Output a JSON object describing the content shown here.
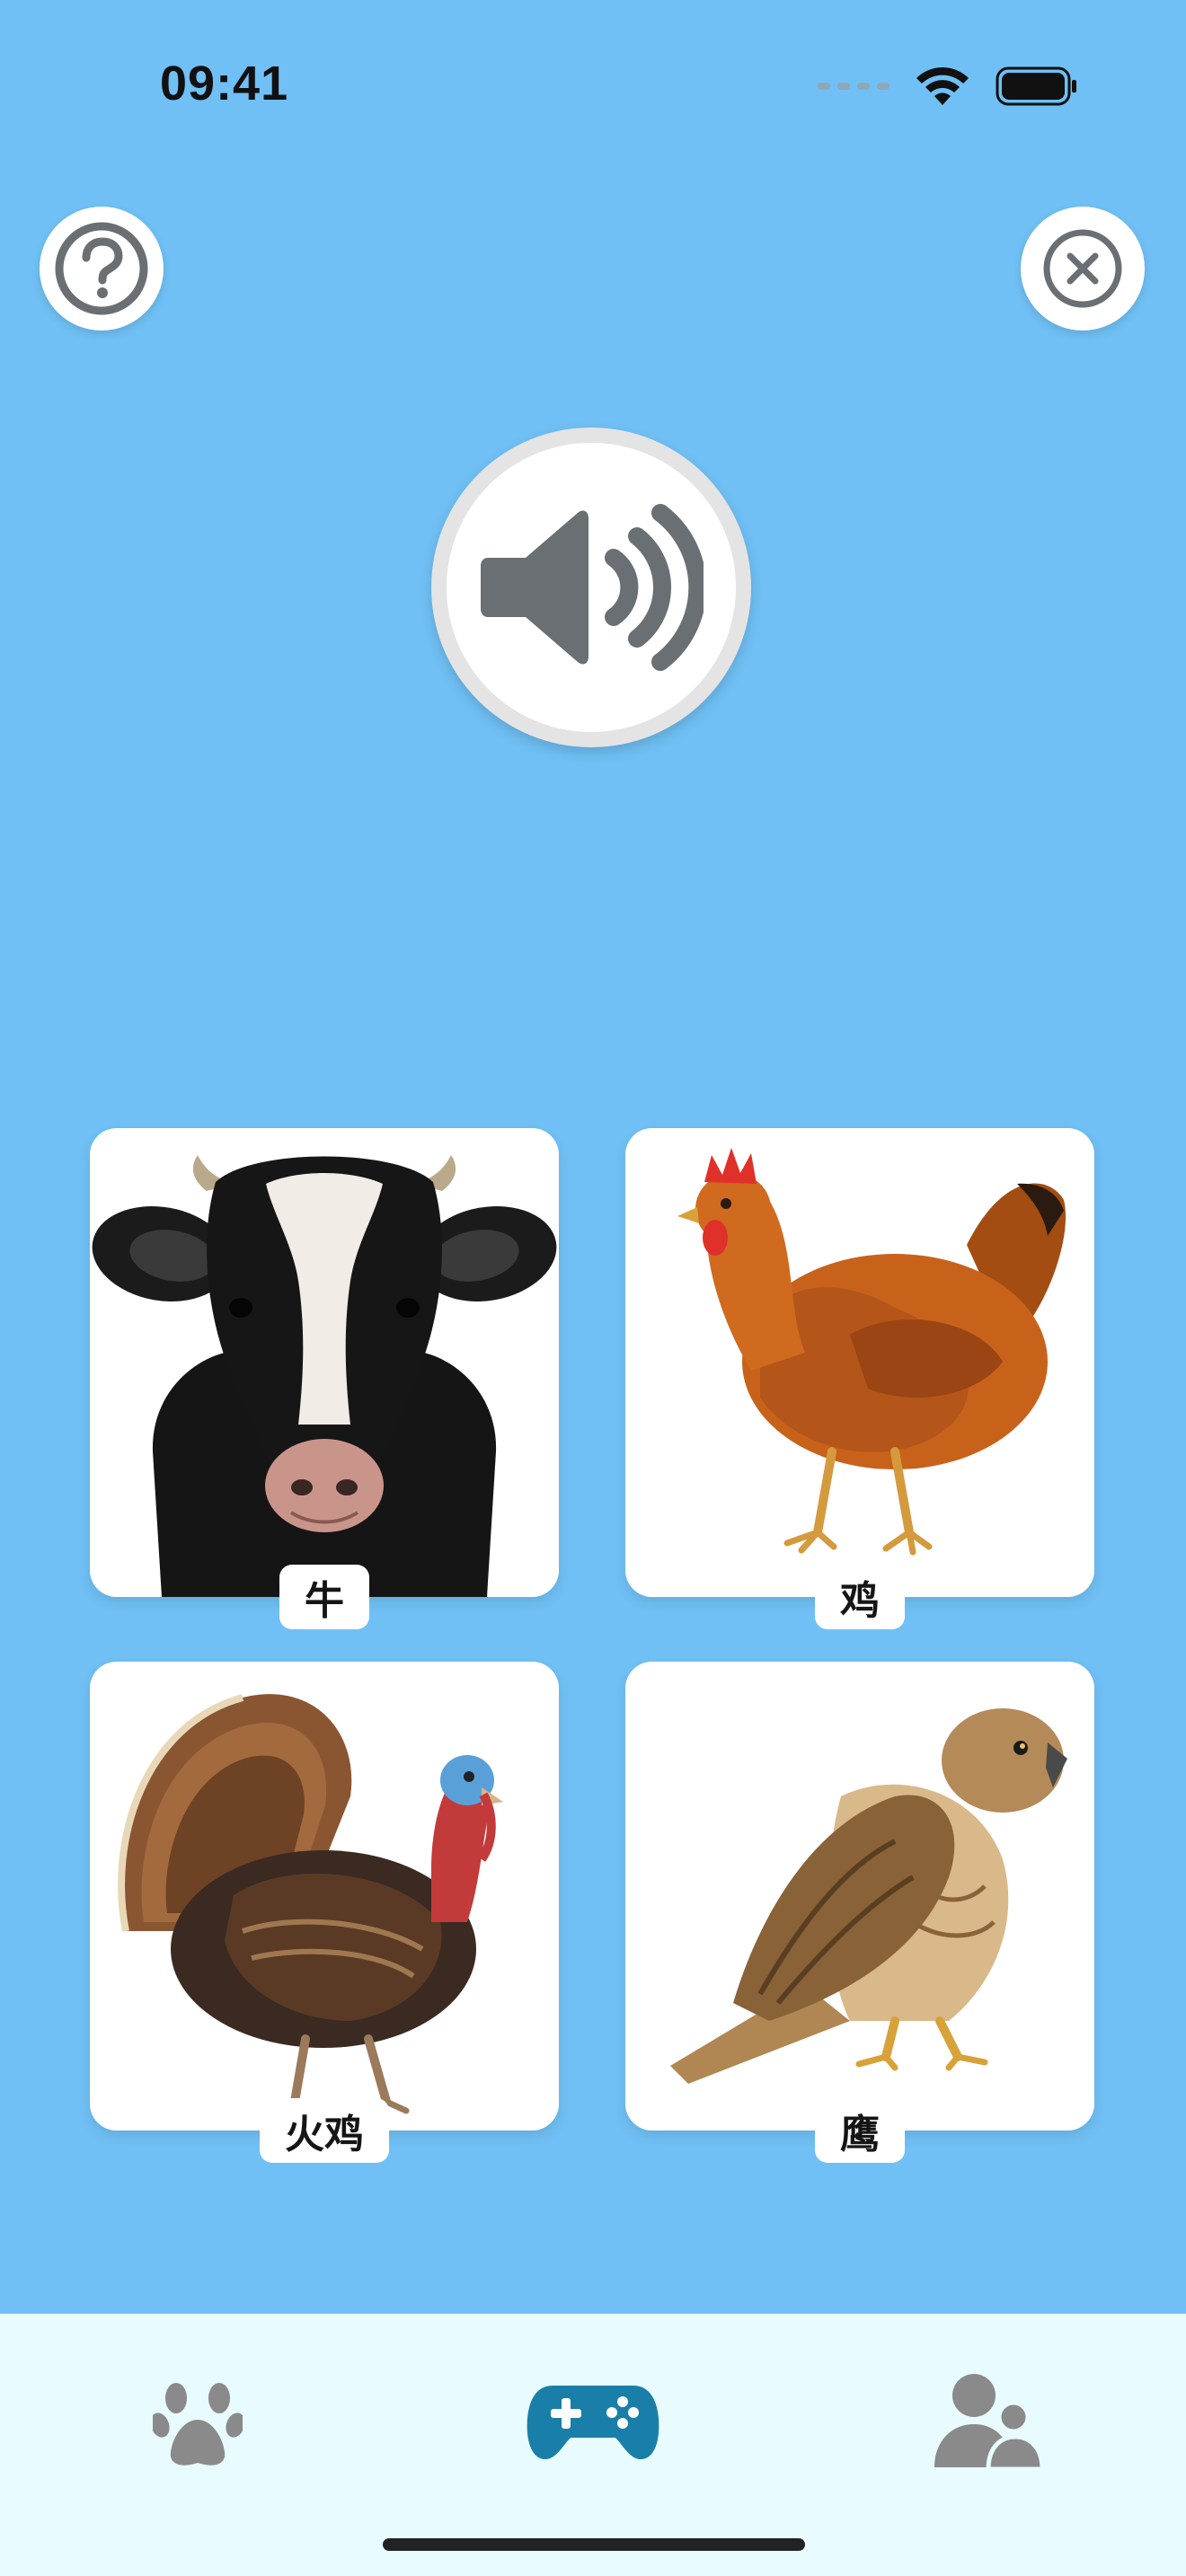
{
  "status_bar": {
    "time": "09:41"
  },
  "icons": {
    "help": "question-circle-icon",
    "close": "x-circle-icon",
    "sound": "speaker-volume-icon",
    "tab_animals": "paw-icon",
    "tab_games": "gamepad-icon",
    "tab_profile": "users-icon"
  },
  "cards": [
    {
      "label": "牛",
      "image": "cow"
    },
    {
      "label": "鸡",
      "image": "chicken"
    },
    {
      "label": "火鸡",
      "image": "turkey"
    },
    {
      "label": "鹰",
      "image": "hawk"
    }
  ],
  "tab_bar": {
    "active": "games"
  },
  "colors": {
    "background": "#70C0F5",
    "tab_bar_background": "#E8FBFE",
    "active_tab": "#1A7FA8",
    "inactive_tab": "#8A8A8A",
    "icon_gray": "#6A6F74"
  }
}
